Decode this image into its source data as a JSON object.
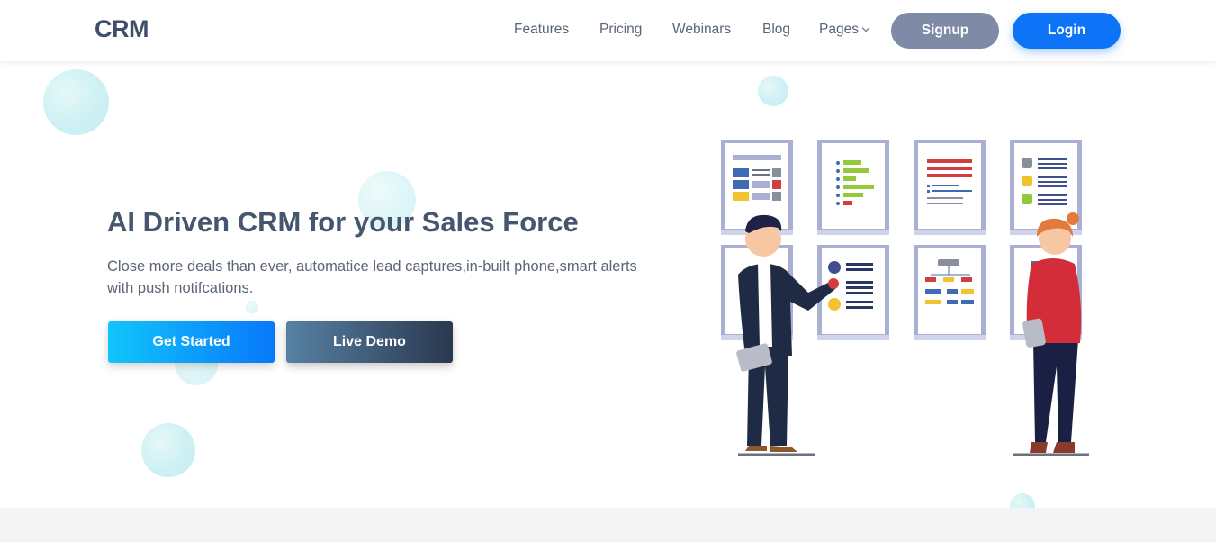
{
  "header": {
    "logo": "CRM",
    "nav": [
      {
        "label": "Features"
      },
      {
        "label": "Pricing"
      },
      {
        "label": "Webinars"
      },
      {
        "label": "Blog"
      },
      {
        "label": "Pages",
        "icon": "chevron-down-icon"
      }
    ],
    "signup_label": "Signup",
    "login_label": "Login"
  },
  "hero": {
    "title": "AI Driven CRM for your Sales Force",
    "subtitle": "Close more deals than ever, automatice lead captures,in-built phone,smart alerts with push notifcations.",
    "primary_button": "Get Started",
    "secondary_button": "Live Demo"
  },
  "colors": {
    "text_dark": "#45566f",
    "signup_bg": "#7f8aa6",
    "login_bg": "#0d73f7",
    "primary_gradient": [
      "#11c5fb",
      "#0878fb"
    ],
    "secondary_gradient": [
      "#5781a3",
      "#2a384f"
    ]
  }
}
